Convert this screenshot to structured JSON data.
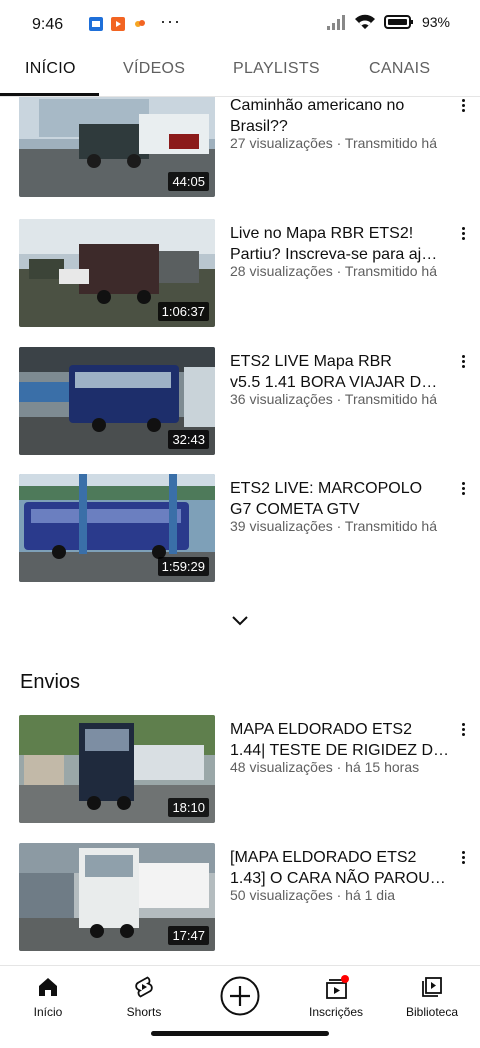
{
  "status_bar": {
    "time": "9:46",
    "battery": "93%"
  },
  "tabs": [
    {
      "label": "INÍCIO",
      "active": true
    },
    {
      "label": "VÍDEOS",
      "active": false
    },
    {
      "label": "PLAYLISTS",
      "active": false
    },
    {
      "label": "CANAIS",
      "active": false
    }
  ],
  "videos": [
    {
      "title_line1": "Caminhão americano no",
      "title_line2": "Brasil??",
      "meta": "27 visualizações · Transmitido há",
      "duration": "44:05"
    },
    {
      "title_line1": "Live no Mapa RBR ETS2!",
      "title_line2": "Partiu? Inscreva-se para aj…",
      "meta": "28 visualizações · Transmitido há",
      "duration": "1:06:37"
    },
    {
      "title_line1": "ETS2 LIVE Mapa RBR",
      "title_line2": "v5.5 1.41 BORA VIAJAR D…",
      "meta": "36 visualizações · Transmitido há",
      "duration": "32:43"
    },
    {
      "title_line1": "ETS2 LIVE: MARCOPOLO",
      "title_line2": "G7 COMETA GTV",
      "meta": "39 visualizações · Transmitido há",
      "duration": "1:59:29"
    }
  ],
  "uploads": {
    "section_title": "Envios",
    "videos": [
      {
        "title_line1": "MAPA ELDORADO ETS2",
        "title_line2": "1.44| TESTE DE RIGIDEZ D…",
        "meta": "48 visualizações · há 15 horas",
        "duration": "18:10"
      },
      {
        "title_line1": "[MAPA ELDORADO ETS2",
        "title_line2": "1.43] O CARA NÃO PAROU…",
        "meta": "50 visualizações · há 1 dia",
        "duration": "17:47"
      }
    ]
  },
  "bottom_nav": [
    {
      "label": "Início",
      "icon": "home-icon"
    },
    {
      "label": "Shorts",
      "icon": "shorts-icon"
    },
    {
      "label": "",
      "icon": "create-icon"
    },
    {
      "label": "Inscrições",
      "icon": "subscriptions-icon"
    },
    {
      "label": "Biblioteca",
      "icon": "library-icon"
    }
  ],
  "colors": {
    "accent_red": "#ff0000",
    "text_primary": "#0f0f0f",
    "text_secondary": "#606060"
  }
}
